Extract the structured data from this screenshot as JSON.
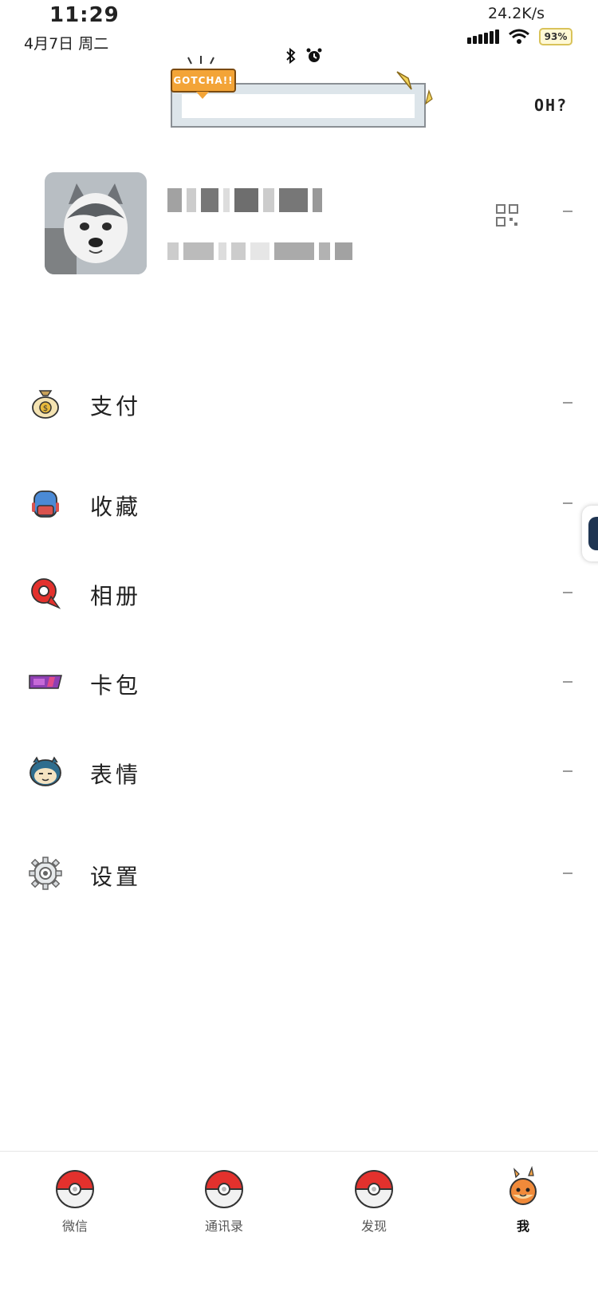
{
  "status_bar": {
    "time": "11:29",
    "date": "4月7日  周二",
    "net_speed": "24.2K/s",
    "battery": "93%"
  },
  "header": {
    "badge_text": "GOTCHA!!",
    "right_text": "OH?"
  },
  "menu": [
    {
      "label": "支付",
      "icon": "money-bag-icon"
    },
    {
      "label": "收藏",
      "icon": "backpack-icon"
    },
    {
      "label": "相册",
      "icon": "pokedex-icon"
    },
    {
      "label": "卡包",
      "icon": "card-icon"
    },
    {
      "label": "表情",
      "icon": "snorlax-icon"
    },
    {
      "label": "设置",
      "icon": "gear-icon"
    }
  ],
  "tabbar": [
    {
      "label": "微信",
      "icon": "pokeball-icon"
    },
    {
      "label": "通讯录",
      "icon": "pokeball-icon"
    },
    {
      "label": "发现",
      "icon": "pokeball-icon"
    },
    {
      "label": "我",
      "icon": "charmander-icon",
      "active": true
    }
  ],
  "colors": {
    "accent": "#f3a437",
    "pokeball_red": "#e3312d",
    "card_purple": "#8e3fb3"
  }
}
